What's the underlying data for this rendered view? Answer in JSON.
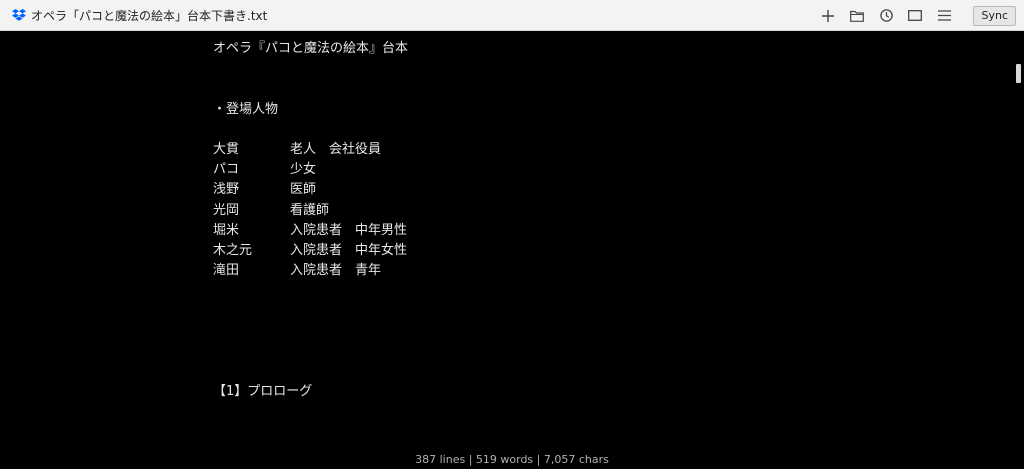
{
  "window": {
    "title": "オペラ「パコと魔法の絵本」台本下書き.txt",
    "app_icon": "dropbox-icon"
  },
  "toolbar": {
    "icons": [
      "plus-icon",
      "folder-icon",
      "clock-icon",
      "window-icon",
      "menu-icon"
    ],
    "sync_label": "Sync"
  },
  "document": {
    "title": "オペラ『パコと魔法の絵本』台本",
    "section_heading": "・登場人物",
    "characters": [
      {
        "name": "大貫",
        "role": "老人　会社役員"
      },
      {
        "name": "パコ",
        "role": "少女"
      },
      {
        "name": "浅野",
        "role": "医師"
      },
      {
        "name": "光岡",
        "role": "看護師"
      },
      {
        "name": "堀米",
        "role": "入院患者　中年男性"
      },
      {
        "name": "木之元",
        "role": "入院患者　中年女性"
      },
      {
        "name": "滝田",
        "role": "入院患者　青年"
      }
    ],
    "scene_heading": "【1】プロローグ"
  },
  "status": {
    "text": "387 lines | 519 words | 7,057 chars"
  },
  "colors": {
    "editor_background": "#000000",
    "text": "#e8e8e8",
    "titlebar": "#f3f3f3",
    "dropbox_blue": "#0061fe"
  }
}
